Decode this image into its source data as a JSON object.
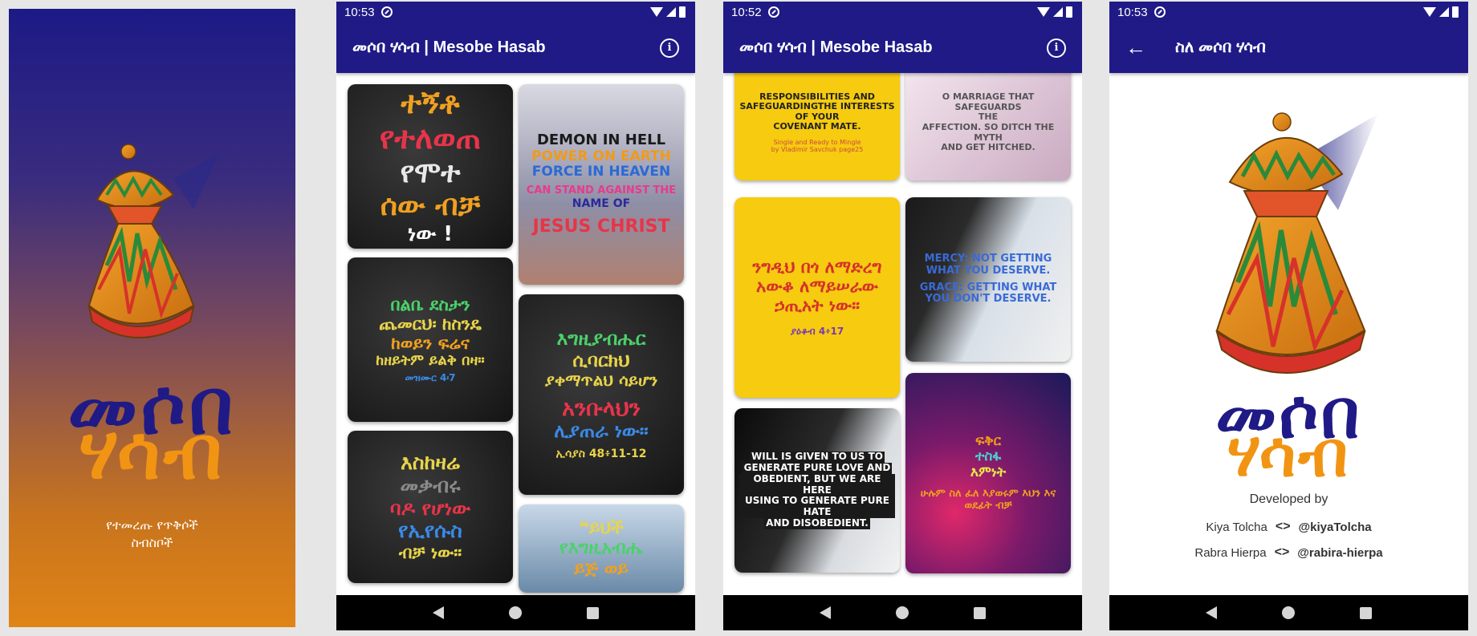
{
  "splash": {
    "title_line1": "መሶበ",
    "title_line2": "ሃሳብ",
    "subtitle_line1": "የተመረጡ የጥቅሶች",
    "subtitle_line2": "ስብስቦች"
  },
  "status": {
    "time1": "10:53",
    "time2": "10:52",
    "time3": "10:53"
  },
  "appbar": {
    "title": "መሶበ ሃሳብ | Mesobe Hasab",
    "info_icon": "info-icon"
  },
  "feed1": {
    "card1": {
      "l1": "ተኝቶ",
      "l2": "የተለወጠ",
      "l3": "የሞተ",
      "l4": "ሰው ብቻ",
      "l5": "ነው !"
    },
    "card2": {
      "l1": "DEMON IN HELL",
      "l2": "POWER ON EARTH",
      "l3": "FORCE IN HEAVEN",
      "l4": "CAN STAND AGAINST THE",
      "l5": "NAME OF",
      "l6": "JESUS CHRIST"
    },
    "card3": {
      "l1": "በልቤ ደስታን",
      "l2": "ጨመርህ፡ ከስንዴ",
      "l3": "ከወይን   ፍሬና",
      "l4": "ከዘይትም ይልቅ በዛ።",
      "l5": "መዝሙር 4፡7"
    },
    "card4": {
      "l1": "እግዚያብሔር",
      "l2": "ሲባርክህ",
      "l3": "ያቀማጥልህ ሳይሆን",
      "l4": "አንቡላህን",
      "l5": "ሊያጠራ ነው።",
      "l6": "ኢሳያስ 48፥11-12"
    },
    "card5": {
      "l1": "እስከዛሬ",
      "l2": "መቃብሩ",
      "l3": "ባዶ የሆነው",
      "l4": "የኢየሱስ",
      "l5": "ብቻ ነው።"
    },
    "card6": {
      "l1": "❝ይህች",
      "l2": "የእግዚአብሔ",
      "l3": "ይጅ ወይ"
    }
  },
  "feed2": {
    "card1": {
      "l1": "RESPONSIBILITIES AND",
      "l2": "SAFEGUARDINGTHE INTERESTS",
      "l3": "OF YOUR",
      "l4": "COVENANT MATE.",
      "l5": "Single and Ready to Mingle",
      "l6": "by Vladimir Savchuk page25"
    },
    "card2": {
      "l1": "O MARRIAGE THAT SAFEGUARDS",
      "l2": "THE",
      "l3": "AFFECTION. SO DITCH THE MYTH",
      "l4": "AND GET HITCHED."
    },
    "card3": {
      "l1": "ንግዲህ በጎ ለማድረግ",
      "l2": "አውቆ ለማይሠራው",
      "l3": "ኃጢአት ነው።",
      "l4": "ያዕቆብ 4፥17"
    },
    "card4": {
      "l1": "MERCY: NOT GETTING",
      "l2": "WHAT YOU DESERVE.",
      "l3": "GRACE: GETTING WHAT",
      "l4": "YOU DON'T DESERVE."
    },
    "card5": {
      "l1": "WILL IS GIVEN TO US TO",
      "l2": "GENERATE PURE LOVE AND",
      "l3": "OBEDIENT, BUT WE ARE HERE",
      "l4": "USING TO GENERATE PURE HATE",
      "l5": "AND DISOBEDIENT."
    },
    "card6": {
      "l1": "ፍቅር",
      "l2": "ተስፋ",
      "l3": "እምነት",
      "l4": "ሁሉም ስለ ፈለ እያወሩም እህን እና",
      "l5": "ወደፊት ብቻ"
    }
  },
  "about": {
    "title": "ስለ መሶበ ሃሳብ",
    "title_line1": "መሶበ",
    "title_line2": "ሃሳብ",
    "developed_by": "Developed by",
    "devs": [
      {
        "name": "Kiya Tolcha",
        "handle": "@kiyaTolcha"
      },
      {
        "name": "Rabra Hierpa",
        "handle": "@rabira-hierpa"
      }
    ],
    "code_glyph": "<>"
  }
}
